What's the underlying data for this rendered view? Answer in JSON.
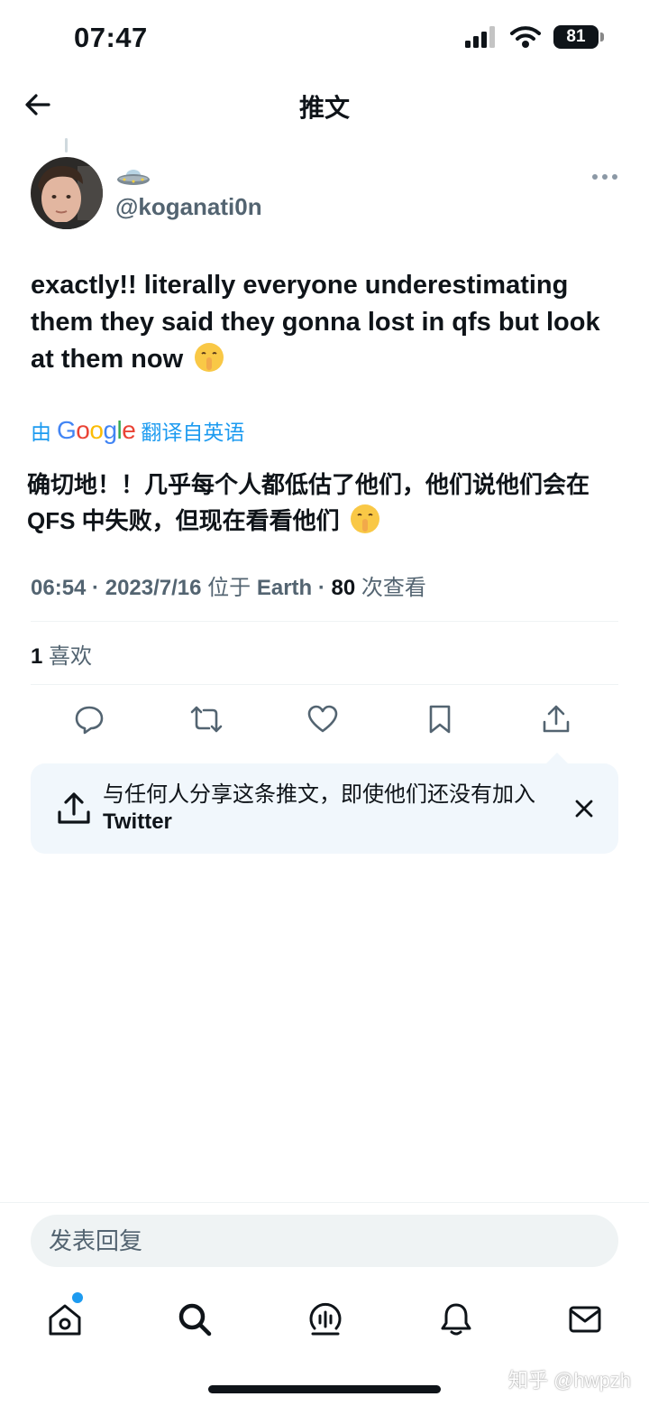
{
  "status_bar": {
    "time": "07:47",
    "battery": "81"
  },
  "header": {
    "title": "推文"
  },
  "tweet": {
    "display_name_icon": "ufo-emoji-icon",
    "handle": "@koganati0n",
    "text": "exactly!! literally everyone underestimating them they said they gonna lost in qfs but look at them now",
    "text_emoji": "shushing-face-icon",
    "translation": {
      "prefix": "由",
      "provider": "Google",
      "suffix": "翻译自英语",
      "text": "确切地！！几乎每个人都低估了他们，他们说他们会在 QFS 中失败，但现在看看他们"
    },
    "meta": {
      "time": "06:54",
      "date": "2023/7/16",
      "location_prefix": "位于",
      "location": "Earth",
      "views": "80",
      "views_label": "次查看"
    },
    "likes": {
      "count": "1",
      "label": "喜欢"
    }
  },
  "actions": [
    {
      "name": "reply-button",
      "icon": "reply-icon"
    },
    {
      "name": "retweet-button",
      "icon": "retweet-icon"
    },
    {
      "name": "like-button",
      "icon": "heart-icon"
    },
    {
      "name": "bookmark-button",
      "icon": "bookmark-icon"
    },
    {
      "name": "share-button",
      "icon": "share-icon"
    }
  ],
  "share_banner": {
    "text": "与任何人分享这条推文，即使他们还没有加入",
    "brand": "Twitter"
  },
  "reply": {
    "placeholder": "发表回复"
  },
  "tabbar": [
    {
      "name": "tab-home",
      "icon": "home-icon",
      "has_notification": true
    },
    {
      "name": "tab-search",
      "icon": "search-icon"
    },
    {
      "name": "tab-spaces",
      "icon": "spaces-icon"
    },
    {
      "name": "tab-notifications",
      "icon": "bell-icon"
    },
    {
      "name": "tab-messages",
      "icon": "mail-icon"
    }
  ],
  "watermark": "知乎 @hwpzh",
  "colors": {
    "accent": "#1d9bf0",
    "secondary_text": "#536471",
    "text": "#0f1419",
    "banner_bg": "#f1f7fc"
  }
}
